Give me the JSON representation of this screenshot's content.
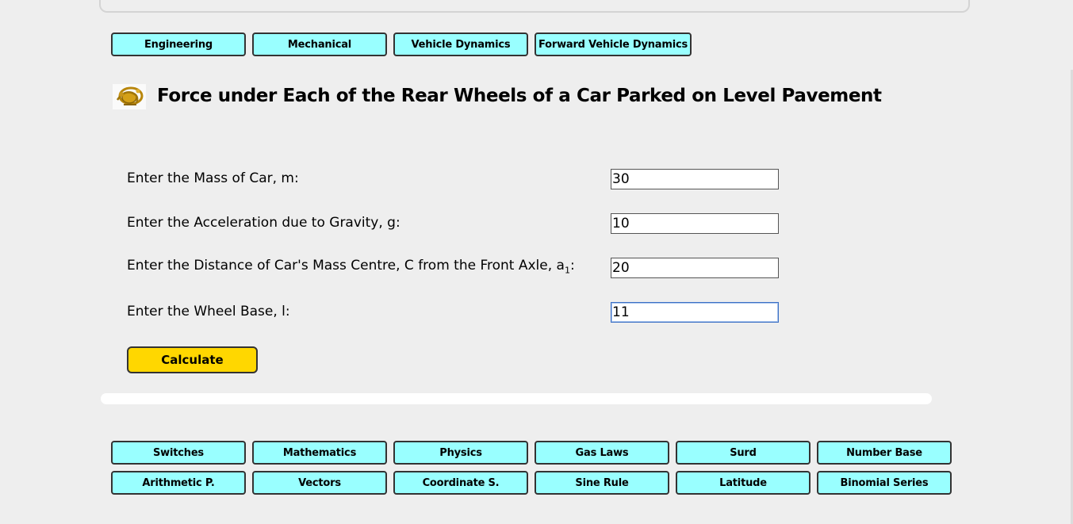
{
  "breadcrumbs": [
    "Engineering",
    "Mechanical",
    "Vehicle Dynamics",
    "Forward Vehicle Dynamics"
  ],
  "page_title": "Force under Each of the Rear Wheels of a Car Parked on Level Pavement",
  "logo_icon": "gold-emblem-icon",
  "form": {
    "fields": [
      {
        "label": "Enter the Mass of Car, m:",
        "value": "30"
      },
      {
        "label": "Enter the Acceleration due to Gravity, g:",
        "value": "10"
      },
      {
        "label_main": "Enter the Distance of Car's Mass Centre, C from the Front Axle, a",
        "label_sub": "1",
        "label_tail": ":",
        "value": "20"
      },
      {
        "label": "Enter the Wheel Base, l:",
        "value": "11"
      }
    ],
    "calculate_label": "Calculate"
  },
  "footer_links": {
    "row1": [
      "Switches",
      "Mathematics",
      "Physics",
      "Gas Laws",
      "Surd",
      "Number Base"
    ],
    "row2": [
      "Arithmetic P.",
      "Vectors",
      "Coordinate S.",
      "Sine Rule",
      "Latitude",
      "Binomial Series"
    ]
  },
  "colors": {
    "nav_button": "#99ffff",
    "calculate_button": "#ffd700",
    "background": "#eeeeee"
  }
}
